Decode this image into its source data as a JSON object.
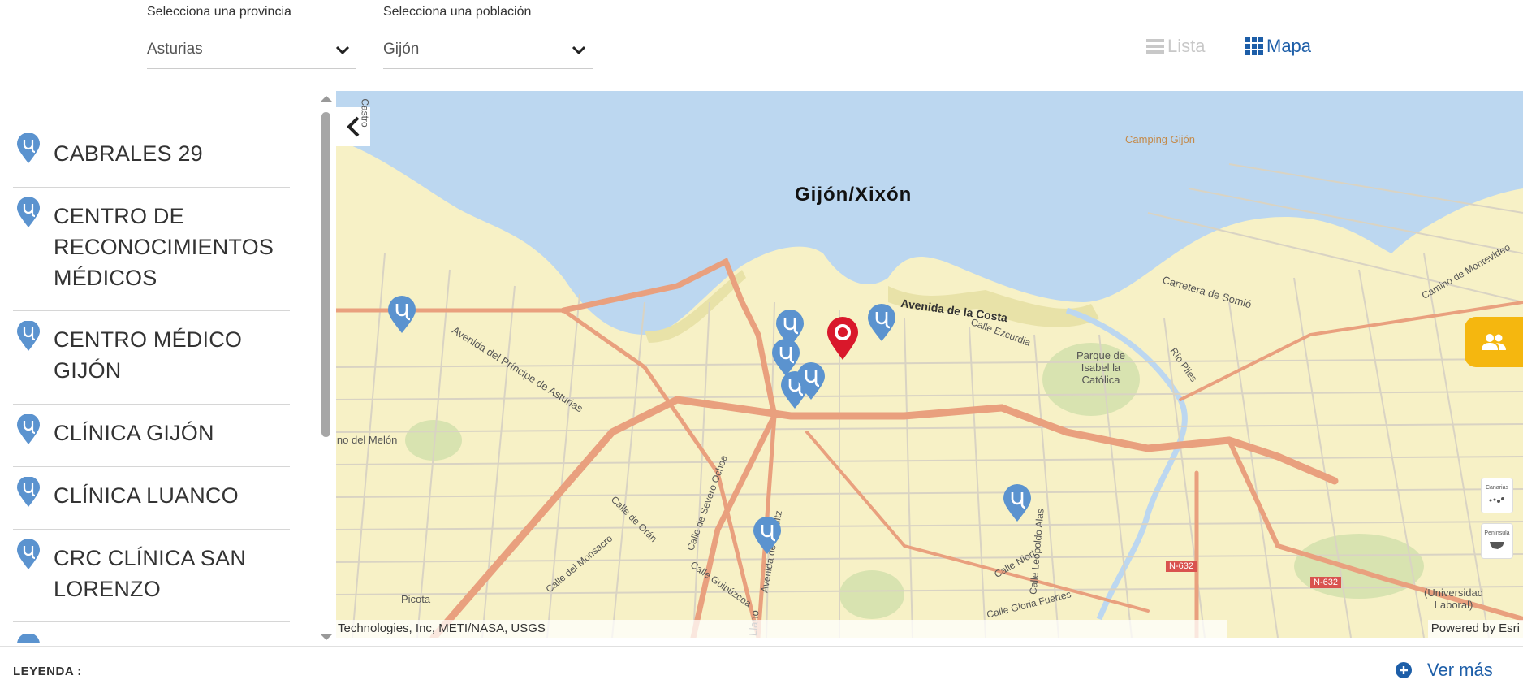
{
  "filters": {
    "province": {
      "label": "Selecciona una provincia",
      "value": "Asturias"
    },
    "town": {
      "label": "Selecciona una población",
      "value": "Gijón"
    }
  },
  "view": {
    "list_label": "Lista",
    "map_label": "Mapa",
    "active": "Mapa"
  },
  "centers": [
    {
      "name": "CABRALES 29"
    },
    {
      "name": "CENTRO DE\nRECONOCIMIENTOS\nMÉDICOS"
    },
    {
      "name": "CENTRO MÉDICO\nGIJÓN"
    },
    {
      "name": "CLÍNICA GIJÓN"
    },
    {
      "name": "CLÍNICA LUANCO"
    },
    {
      "name": "CRC CLÍNICA SAN\nLORENZO"
    }
  ],
  "map": {
    "city": "Gijón/Xixón",
    "streets": [
      "Avenida de la Costa",
      "Carretera de Somió",
      "Avenida del Príncipe de Asturias",
      "Avenida de Schultz",
      "Avenida del Llano",
      "Calle Ezcurdia",
      "Río Piles",
      "Calle Leopoldo Alas",
      "Calle Gloria Fuertes",
      "Calle Niort",
      "Calle de Orán",
      "Calle del Monsacro",
      "Calle Guipúzcoa",
      "Calle de Severo Ochoa",
      "Camino de Montevideo"
    ],
    "places": [
      "Camping Gijón",
      "Parque de\nIsabel la\nCatólica",
      "Picota",
      "(Universidad\nLaboral)",
      "ino del Melón",
      "Castro"
    ],
    "road_badges": [
      "N-632",
      "N-632"
    ],
    "mini_buttons": [
      "Canarias",
      "Península"
    ],
    "attribution_left": "Technologies, Inc, METI/NASA, USGS",
    "attribution_right": "Powered by Esri"
  },
  "footer": {
    "legend": "LEYENDA :",
    "more": "Ver más"
  },
  "colors": {
    "accent": "#1d5ea8",
    "pin": "#5b93cf",
    "selected_pin": "#d9182b",
    "water": "#bcd7f0",
    "land": "#f7f1c6",
    "road": "#e9a07e",
    "fab": "#f5b70f"
  }
}
